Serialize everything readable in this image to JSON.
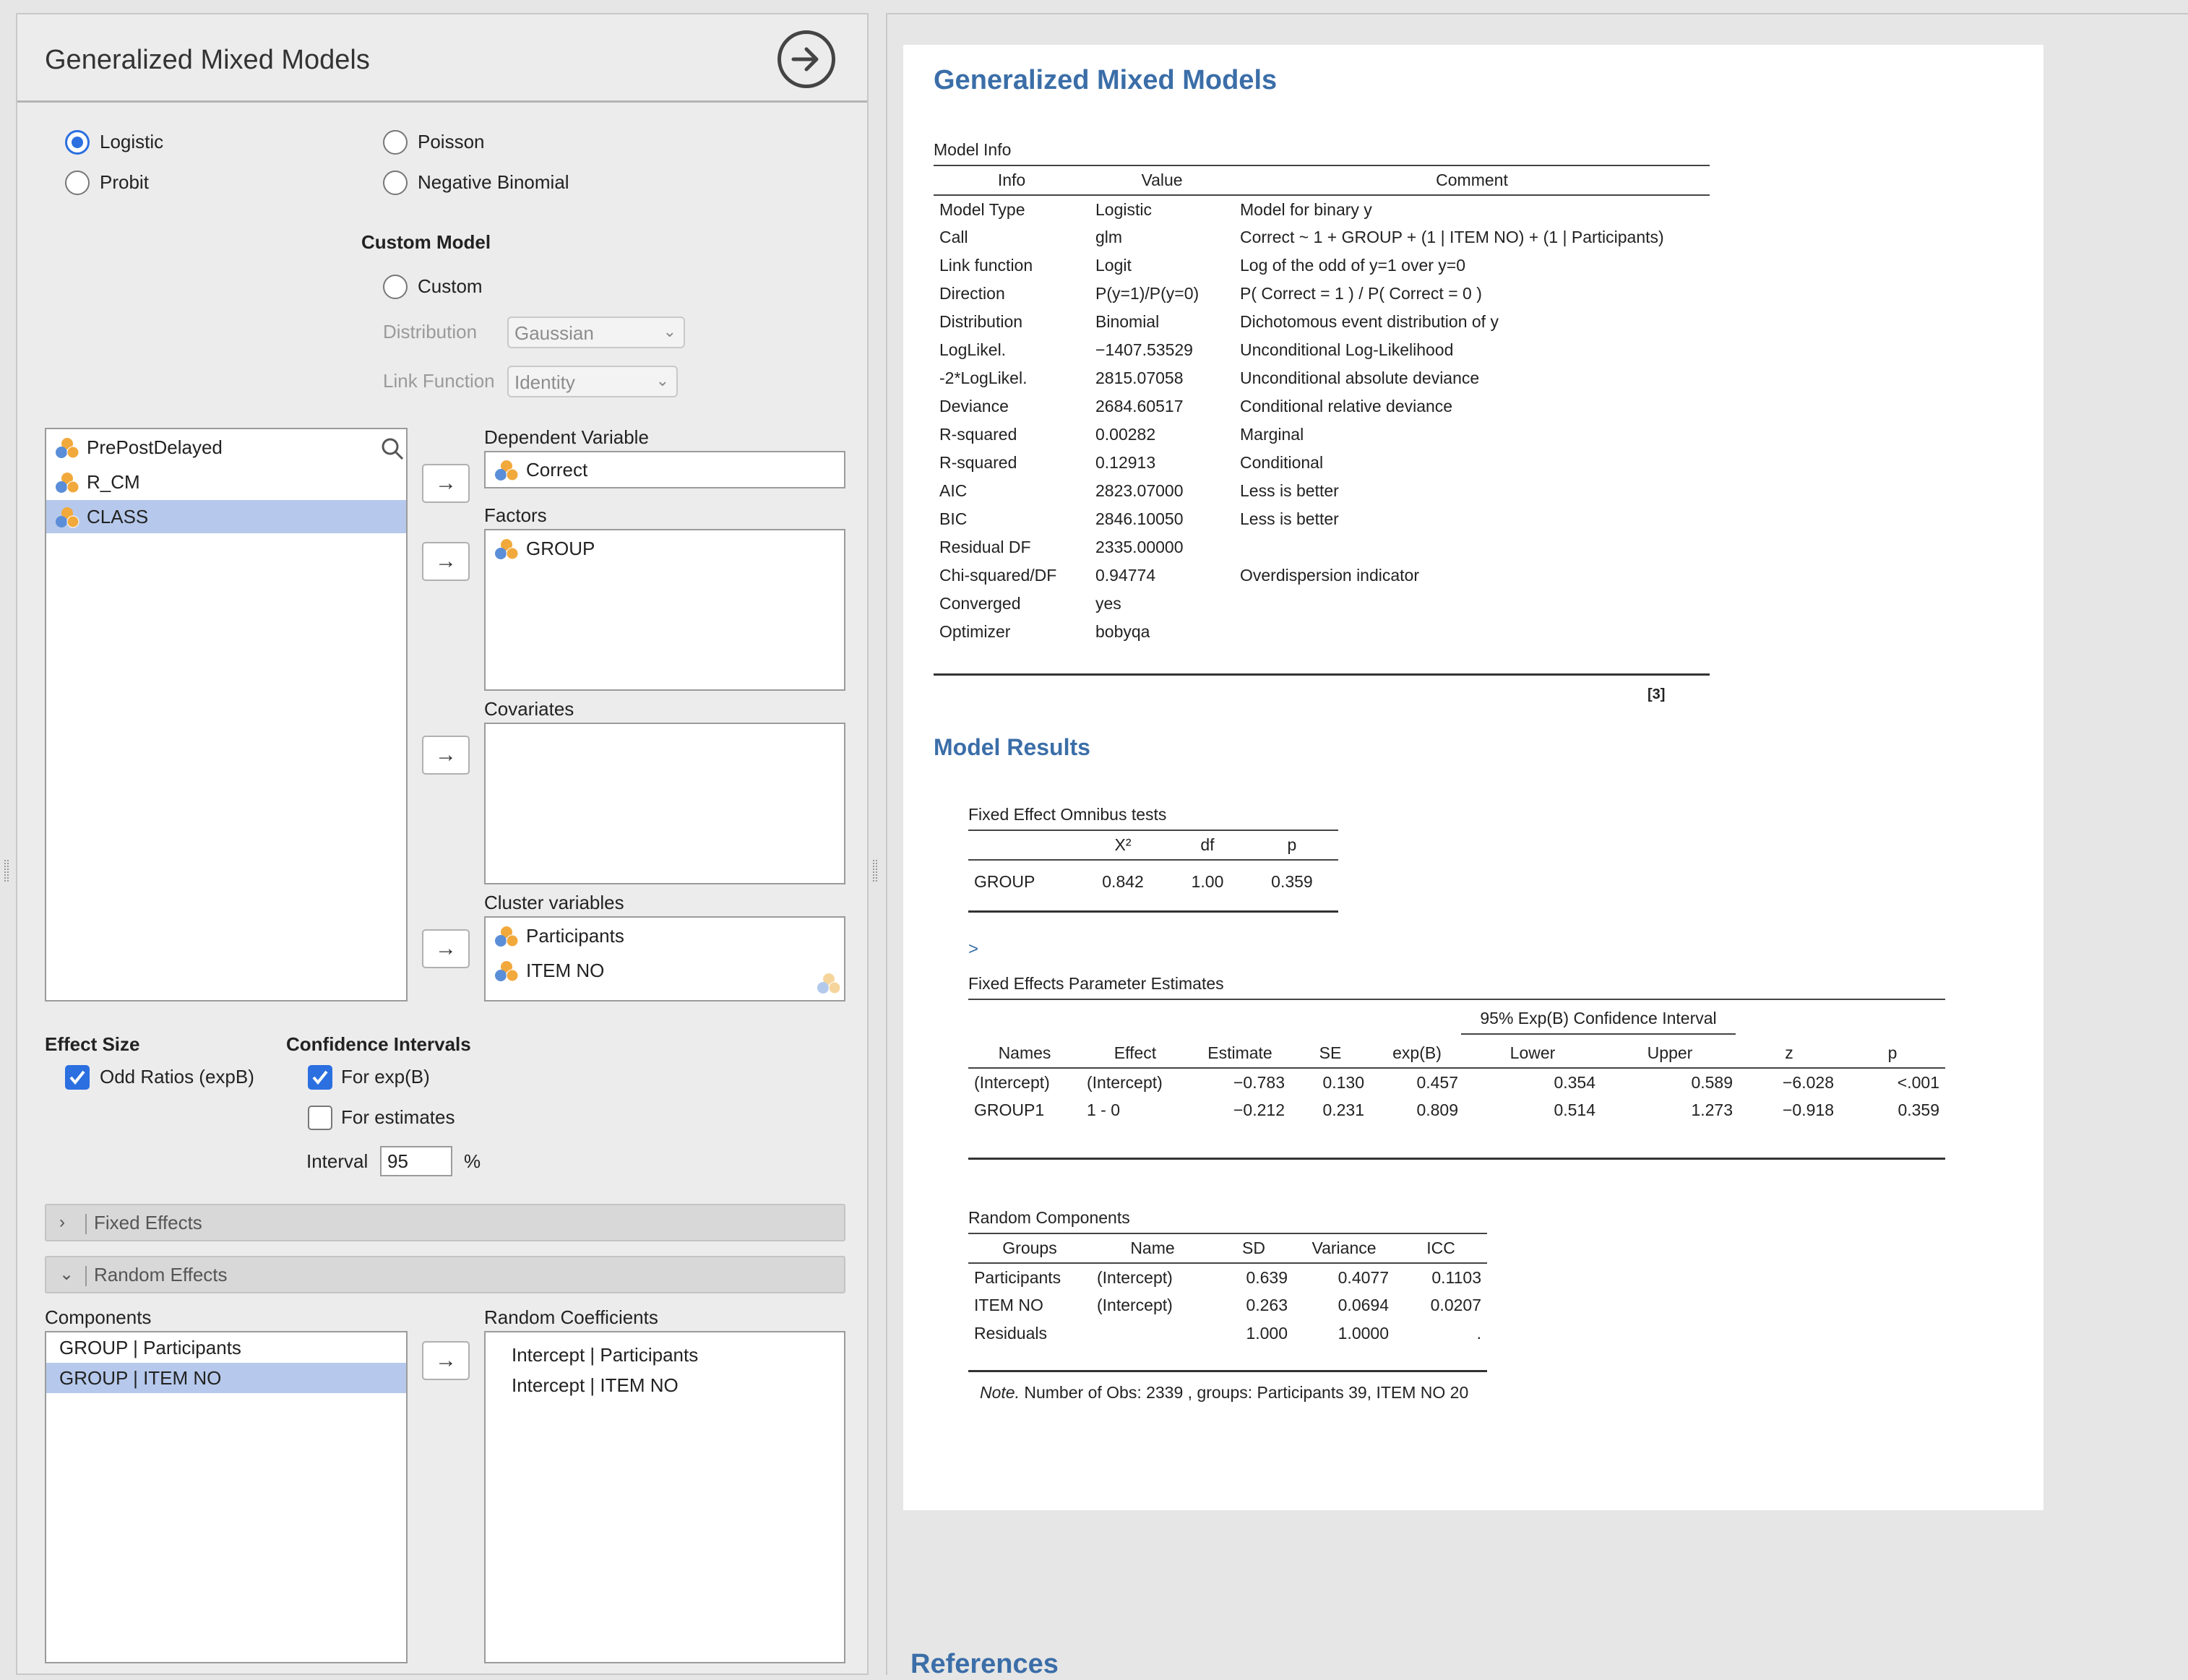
{
  "left": {
    "title": "Generalized Mixed Models",
    "model_types": [
      {
        "label": "Logistic",
        "selected": true
      },
      {
        "label": "Probit",
        "selected": false
      },
      {
        "label": "Poisson",
        "selected": false
      },
      {
        "label": "Negative Binomial",
        "selected": false
      }
    ],
    "custom_model": {
      "heading": "Custom Model",
      "custom_label": "Custom",
      "distribution_label": "Distribution",
      "distribution_value": "Gaussian",
      "link_label": "Link Function",
      "link_value": "Identity"
    },
    "variables": [
      "PrePostDelayed",
      "R_CM",
      "CLASS"
    ],
    "dependent": {
      "label": "Dependent Variable",
      "value": "Correct"
    },
    "factors": {
      "label": "Factors",
      "items": [
        "GROUP"
      ]
    },
    "covariates": {
      "label": "Covariates"
    },
    "cluster": {
      "label": "Cluster variables",
      "items": [
        "Participants",
        "ITEM NO"
      ]
    },
    "effect_size": {
      "heading": "Effect Size",
      "option": "Odd Ratios (expB)",
      "checked": true
    },
    "conf_int": {
      "heading": "Confidence Intervals",
      "for_expb": "For exp(B)",
      "for_expb_checked": true,
      "for_estimates": "For estimates",
      "for_estimates_checked": false,
      "interval_label": "Interval",
      "interval_value": "95",
      "percent": "%"
    },
    "fixed_effects_section": "Fixed Effects",
    "random_effects_section": "Random Effects",
    "components": {
      "label": "Components",
      "items": [
        "GROUP | Participants",
        "GROUP | ITEM NO"
      ]
    },
    "random_coefficients": {
      "label": "Random Coefficients",
      "items": [
        "Intercept | Participants",
        "Intercept | ITEM NO"
      ]
    }
  },
  "results": {
    "title": "Generalized Mixed Models",
    "model_info": {
      "title": "Model Info",
      "columns": [
        "Info",
        "Value",
        "Comment"
      ],
      "rows": [
        [
          "Model Type",
          "Logistic",
          "Model for binary y"
        ],
        [
          "Call",
          "glm",
          "Correct ~ 1 + GROUP + (1 | ITEM NO) + (1 | Participants)"
        ],
        [
          "Link function",
          "Logit",
          "Log of the odd of y=1 over y=0"
        ],
        [
          "Direction",
          "P(y=1)/P(y=0)",
          "P( Correct = 1 ) / P( Correct = 0 )"
        ],
        [
          "Distribution",
          "Binomial",
          "Dichotomous event distribution of y"
        ],
        [
          "LogLikel.",
          "−1407.53529",
          "Unconditional Log-Likelihood"
        ],
        [
          "-2*LogLikel.",
          "2815.07058",
          "Unconditional absolute deviance"
        ],
        [
          "Deviance",
          "2684.60517",
          "Conditional relative deviance"
        ],
        [
          "R-squared",
          "0.00282",
          "Marginal"
        ],
        [
          "R-squared",
          "0.12913",
          "Conditional"
        ],
        [
          "AIC",
          "2823.07000",
          "Less is better"
        ],
        [
          "BIC",
          "2846.10050",
          "Less is better"
        ],
        [
          "Residual DF",
          "2335.00000",
          ""
        ],
        [
          "Chi-squared/DF",
          "0.94774",
          "Overdispersion indicator"
        ],
        [
          "Converged",
          "yes",
          ""
        ],
        [
          "Optimizer",
          "bobyqa",
          ""
        ]
      ],
      "footnote_ref": "[3]"
    },
    "model_results_title": "Model Results",
    "omnibus": {
      "title": "Fixed Effect Omnibus tests",
      "columns": [
        "",
        "X²",
        "df",
        "p"
      ],
      "rows": [
        [
          "GROUP",
          "0.842",
          "1.00",
          "0.359"
        ]
      ]
    },
    "expand_marker": ">",
    "params": {
      "title": "Fixed Effects Parameter Estimates",
      "ci_header": "95% Exp(B) Confidence Interval",
      "columns": [
        "Names",
        "Effect",
        "Estimate",
        "SE",
        "exp(B)",
        "Lower",
        "Upper",
        "z",
        "p"
      ],
      "rows": [
        [
          "(Intercept)",
          "(Intercept)",
          "−0.783",
          "0.130",
          "0.457",
          "0.354",
          "0.589",
          "−6.028",
          "<.001"
        ],
        [
          "GROUP1",
          "1 - 0",
          "−0.212",
          "0.231",
          "0.809",
          "0.514",
          "1.273",
          "−0.918",
          "0.359"
        ]
      ]
    },
    "random": {
      "title": "Random Components",
      "columns": [
        "Groups",
        "Name",
        "SD",
        "Variance",
        "ICC"
      ],
      "rows": [
        [
          "Participants",
          "(Intercept)",
          "0.639",
          "0.4077",
          "0.1103"
        ],
        [
          "ITEM NO",
          "(Intercept)",
          "0.263",
          "0.0694",
          "0.0207"
        ],
        [
          "Residuals",
          "",
          "1.000",
          "1.0000",
          "."
        ]
      ],
      "note_label": "Note.",
      "note_text": " Number of Obs: 2339 , groups: Participants 39, ITEM NO 20"
    },
    "references_title": "References"
  },
  "colors": {
    "accent": "#2b6fe0",
    "heading_blue": "#3b6ea8",
    "selection": "#b6c9ec"
  }
}
